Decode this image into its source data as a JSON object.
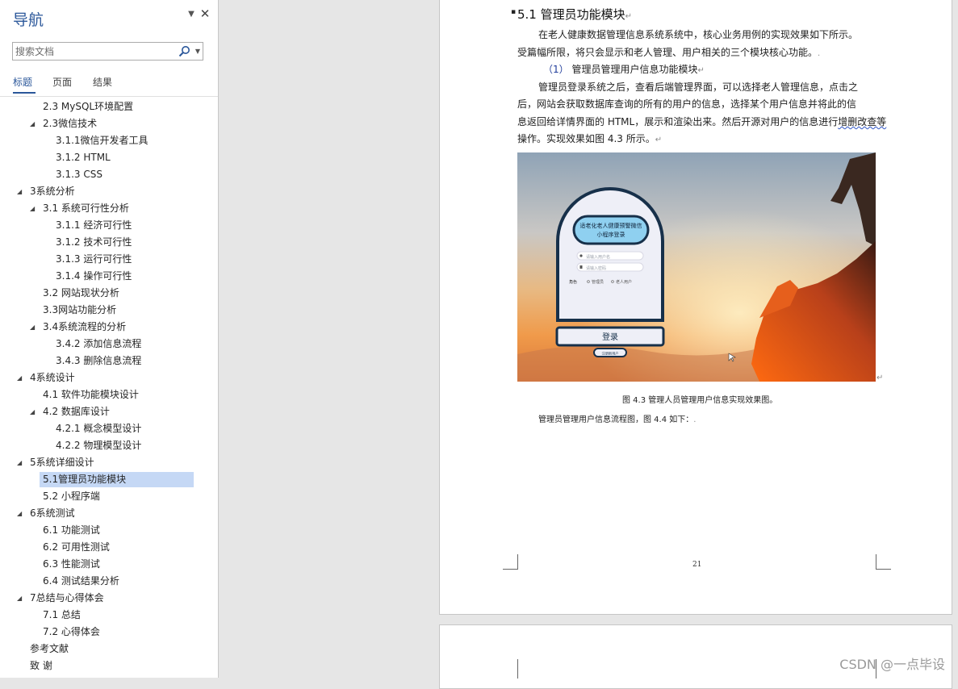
{
  "nav": {
    "title": "导航",
    "search_placeholder": "搜索文档",
    "tabs": [
      "标题",
      "页面",
      "结果"
    ],
    "items": [
      {
        "label": "2.3 MySQL环境配置",
        "level": 2,
        "toggle": false
      },
      {
        "label": "2.3微信技术",
        "level": 2,
        "toggle": true
      },
      {
        "label": "3.1.1微信开发者工具",
        "level": 3,
        "toggle": false
      },
      {
        "label": "3.1.2 HTML",
        "level": 3,
        "toggle": false
      },
      {
        "label": "3.1.3 CSS",
        "level": 3,
        "toggle": false
      },
      {
        "label": "3系统分析",
        "level": 1,
        "toggle": true
      },
      {
        "label": "3.1 系统可行性分析",
        "level": 2,
        "toggle": true
      },
      {
        "label": "3.1.1 经济可行性",
        "level": 3,
        "toggle": false
      },
      {
        "label": "3.1.2 技术可行性",
        "level": 3,
        "toggle": false
      },
      {
        "label": "3.1.3 运行可行性",
        "level": 3,
        "toggle": false
      },
      {
        "label": "3.1.4 操作可行性",
        "level": 3,
        "toggle": false
      },
      {
        "label": "3.2 网站现状分析",
        "level": 2,
        "toggle": false
      },
      {
        "label": "3.3网站功能分析",
        "level": 2,
        "toggle": false
      },
      {
        "label": "3.4系统流程的分析",
        "level": 2,
        "toggle": true
      },
      {
        "label": "3.4.2 添加信息流程",
        "level": 3,
        "toggle": false
      },
      {
        "label": "3.4.3 删除信息流程",
        "level": 3,
        "toggle": false
      },
      {
        "label": "4系统设计",
        "level": 1,
        "toggle": true
      },
      {
        "label": "4.1 软件功能模块设计",
        "level": 2,
        "toggle": false
      },
      {
        "label": "4.2 数据库设计",
        "level": 2,
        "toggle": true
      },
      {
        "label": "4.2.1 概念模型设计",
        "level": 3,
        "toggle": false
      },
      {
        "label": "4.2.2 物理模型设计",
        "level": 3,
        "toggle": false
      },
      {
        "label": "5系统详细设计",
        "level": 1,
        "toggle": true
      },
      {
        "label": "5.1管理员功能模块",
        "level": 2,
        "toggle": false,
        "selected": true
      },
      {
        "label": "5.2 小程序端",
        "level": 2,
        "toggle": false
      },
      {
        "label": "6系统测试",
        "level": 1,
        "toggle": true
      },
      {
        "label": "6.1 功能测试",
        "level": 2,
        "toggle": false
      },
      {
        "label": "6.2 可用性测试",
        "level": 2,
        "toggle": false
      },
      {
        "label": "6.3 性能测试",
        "level": 2,
        "toggle": false
      },
      {
        "label": "6.4 测试结果分析",
        "level": 2,
        "toggle": false
      },
      {
        "label": "7总结与心得体会",
        "level": 1,
        "toggle": true
      },
      {
        "label": "7.1 总结",
        "level": 2,
        "toggle": false
      },
      {
        "label": "7.2 心得体会",
        "level": 2,
        "toggle": false
      },
      {
        "label": "参考文献",
        "level": 1,
        "toggle": false
      },
      {
        "label": "致 谢",
        "level": 1,
        "toggle": false
      }
    ]
  },
  "doc": {
    "heading": "5.1 管理员功能模块",
    "para1_line1": "在老人健康数据管理信息系统系统中，核心业务用例的实现效果如下所示。",
    "para1_line2": "受篇幅所限，将只会显示和老人管理、用户相关的三个模块核心功能。",
    "sub_index": "（1）",
    "sub_title": "管理员管理用户信息功能模块",
    "para2_line1": "管理员登录系统之后，查看后端管理界面，可以选择老人管理信息，点击之",
    "para2_line2": "后，网站会获取数据库查询的所有的用户的信息，选择某个用户信息并将此的信",
    "para2_line3": "息返回给详情界面的 HTML，展示和渲染出来。然后开源对用户的信息进行",
    "para2_wavy": "增删改查等",
    "para2_line4_rest": "操作。实现效果如图 4.3 所示。",
    "caption": "图 4.3  管理人员管理用户信息实现效果图。",
    "flow_text": "管理员管理用户信息流程图，图 4.4 如下：",
    "page_number": "21",
    "mark_return": "↵",
    "mark_dot": ".",
    "bullet_mark": "▪"
  },
  "figure": {
    "app_title_line1": "适老化老人健康预警微信",
    "app_title_line2": "小程序登录",
    "username_placeholder": "请输入用户名",
    "password_placeholder": "请输入密码",
    "role_label": "角色",
    "role_options": [
      "管理员",
      "老人用户"
    ],
    "login_button": "登录",
    "register_link": "注册新用户"
  },
  "watermark": "CSDN @一点毕设"
}
